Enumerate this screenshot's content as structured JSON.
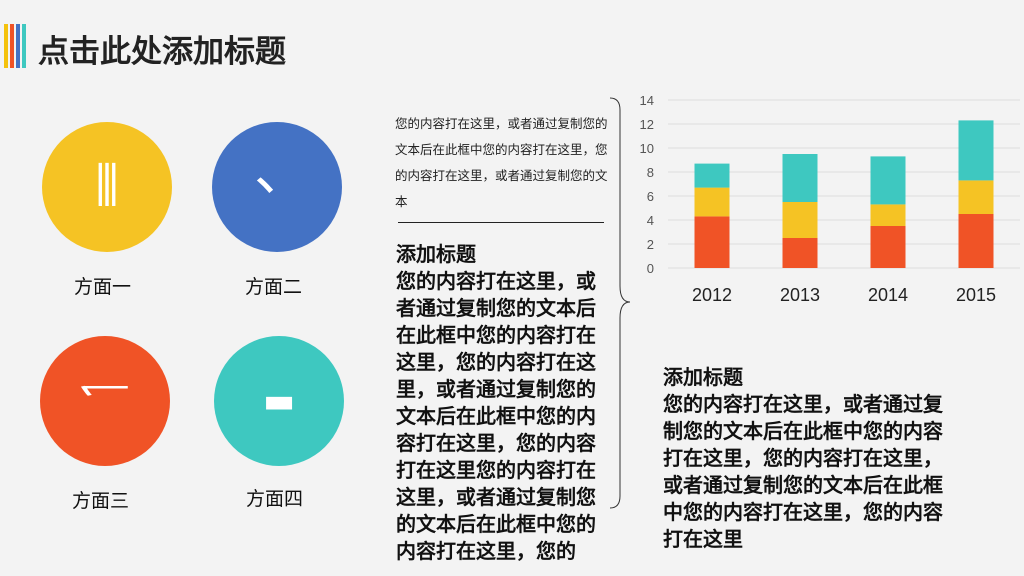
{
  "header": {
    "title": "点击此处添加标题",
    "bar_colors": [
      "#f4c20d",
      "#f05326",
      "#4472c4",
      "#3ec8c0"
    ]
  },
  "aspects": [
    {
      "label": "方面一",
      "glyph": "⫴",
      "icon": "i-beam-icon",
      "color": "#f5c324"
    },
    {
      "label": "方面二",
      "glyph": "、",
      "icon": "dot-stroke-icon",
      "color": "#4472c4"
    },
    {
      "label": "方面三",
      "glyph": "乛",
      "icon": "hook-stroke-icon",
      "color": "#f05326"
    },
    {
      "label": "方面四",
      "glyph": "▬",
      "icon": "dash-icon",
      "color": "#3ec8c0"
    }
  ],
  "small_text": "您的内容打在这里，或者通过复制您的文本后在此框中您的内容打在这里，您的内容打在这里，或者通过复制您的文本",
  "left_block": {
    "title": "添加标题",
    "body": "您的内容打在这里，或者通过复制您的文本后在此框中您的内容打在这里，您的内容打在这里，或者通过复制您的文本后在此框中您的内容打在这里，您的内容打在这里您的内容打在这里，或者通过复制您的文本后在此框中您的内容打在这里，您的"
  },
  "right_block": {
    "title": "添加标题",
    "body": "您的内容打在这里，或者通过复制您的文本后在此框中您的内容打在这里，您的内容打在这里，或者通过复制您的文本后在此框中您的内容打在这里，您的内容打在这里"
  },
  "chart_data": {
    "type": "bar",
    "stacked": true,
    "categories": [
      "2012",
      "2013",
      "2014",
      "2015"
    ],
    "series": [
      {
        "values": [
          4.3,
          2.5,
          3.5,
          4.5
        ],
        "color": "#f05326"
      },
      {
        "values": [
          2.4,
          3.0,
          1.8,
          2.8
        ],
        "color": "#f5c324"
      },
      {
        "values": [
          2.0,
          4.0,
          4.0,
          5.0
        ],
        "color": "#3ec8c0"
      }
    ],
    "yticks": [
      "0",
      "2",
      "4",
      "6",
      "8",
      "10",
      "12",
      "14"
    ],
    "ylim": [
      0,
      14
    ],
    "grid": true,
    "legend": "none"
  }
}
